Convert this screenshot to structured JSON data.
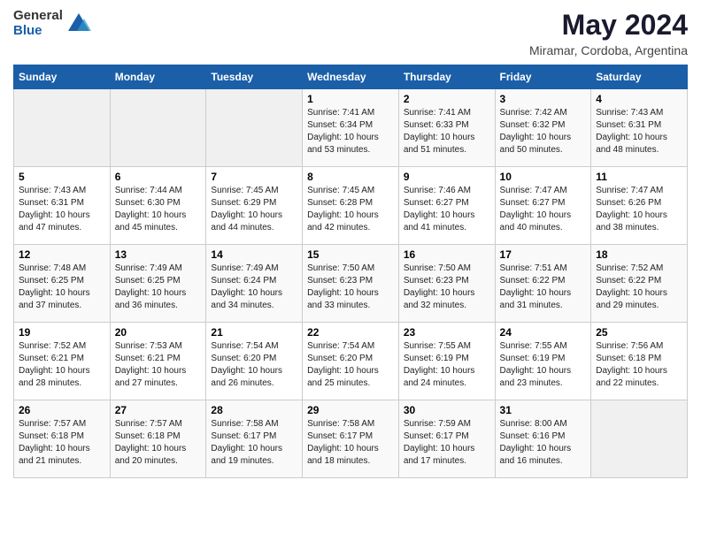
{
  "logo": {
    "general": "General",
    "blue": "Blue"
  },
  "title": "May 2024",
  "subtitle": "Miramar, Cordoba, Argentina",
  "days_of_week": [
    "Sunday",
    "Monday",
    "Tuesday",
    "Wednesday",
    "Thursday",
    "Friday",
    "Saturday"
  ],
  "weeks": [
    [
      {
        "num": "",
        "info": ""
      },
      {
        "num": "",
        "info": ""
      },
      {
        "num": "",
        "info": ""
      },
      {
        "num": "1",
        "info": "Sunrise: 7:41 AM\nSunset: 6:34 PM\nDaylight: 10 hours\nand 53 minutes."
      },
      {
        "num": "2",
        "info": "Sunrise: 7:41 AM\nSunset: 6:33 PM\nDaylight: 10 hours\nand 51 minutes."
      },
      {
        "num": "3",
        "info": "Sunrise: 7:42 AM\nSunset: 6:32 PM\nDaylight: 10 hours\nand 50 minutes."
      },
      {
        "num": "4",
        "info": "Sunrise: 7:43 AM\nSunset: 6:31 PM\nDaylight: 10 hours\nand 48 minutes."
      }
    ],
    [
      {
        "num": "5",
        "info": "Sunrise: 7:43 AM\nSunset: 6:31 PM\nDaylight: 10 hours\nand 47 minutes."
      },
      {
        "num": "6",
        "info": "Sunrise: 7:44 AM\nSunset: 6:30 PM\nDaylight: 10 hours\nand 45 minutes."
      },
      {
        "num": "7",
        "info": "Sunrise: 7:45 AM\nSunset: 6:29 PM\nDaylight: 10 hours\nand 44 minutes."
      },
      {
        "num": "8",
        "info": "Sunrise: 7:45 AM\nSunset: 6:28 PM\nDaylight: 10 hours\nand 42 minutes."
      },
      {
        "num": "9",
        "info": "Sunrise: 7:46 AM\nSunset: 6:27 PM\nDaylight: 10 hours\nand 41 minutes."
      },
      {
        "num": "10",
        "info": "Sunrise: 7:47 AM\nSunset: 6:27 PM\nDaylight: 10 hours\nand 40 minutes."
      },
      {
        "num": "11",
        "info": "Sunrise: 7:47 AM\nSunset: 6:26 PM\nDaylight: 10 hours\nand 38 minutes."
      }
    ],
    [
      {
        "num": "12",
        "info": "Sunrise: 7:48 AM\nSunset: 6:25 PM\nDaylight: 10 hours\nand 37 minutes."
      },
      {
        "num": "13",
        "info": "Sunrise: 7:49 AM\nSunset: 6:25 PM\nDaylight: 10 hours\nand 36 minutes."
      },
      {
        "num": "14",
        "info": "Sunrise: 7:49 AM\nSunset: 6:24 PM\nDaylight: 10 hours\nand 34 minutes."
      },
      {
        "num": "15",
        "info": "Sunrise: 7:50 AM\nSunset: 6:23 PM\nDaylight: 10 hours\nand 33 minutes."
      },
      {
        "num": "16",
        "info": "Sunrise: 7:50 AM\nSunset: 6:23 PM\nDaylight: 10 hours\nand 32 minutes."
      },
      {
        "num": "17",
        "info": "Sunrise: 7:51 AM\nSunset: 6:22 PM\nDaylight: 10 hours\nand 31 minutes."
      },
      {
        "num": "18",
        "info": "Sunrise: 7:52 AM\nSunset: 6:22 PM\nDaylight: 10 hours\nand 29 minutes."
      }
    ],
    [
      {
        "num": "19",
        "info": "Sunrise: 7:52 AM\nSunset: 6:21 PM\nDaylight: 10 hours\nand 28 minutes."
      },
      {
        "num": "20",
        "info": "Sunrise: 7:53 AM\nSunset: 6:21 PM\nDaylight: 10 hours\nand 27 minutes."
      },
      {
        "num": "21",
        "info": "Sunrise: 7:54 AM\nSunset: 6:20 PM\nDaylight: 10 hours\nand 26 minutes."
      },
      {
        "num": "22",
        "info": "Sunrise: 7:54 AM\nSunset: 6:20 PM\nDaylight: 10 hours\nand 25 minutes."
      },
      {
        "num": "23",
        "info": "Sunrise: 7:55 AM\nSunset: 6:19 PM\nDaylight: 10 hours\nand 24 minutes."
      },
      {
        "num": "24",
        "info": "Sunrise: 7:55 AM\nSunset: 6:19 PM\nDaylight: 10 hours\nand 23 minutes."
      },
      {
        "num": "25",
        "info": "Sunrise: 7:56 AM\nSunset: 6:18 PM\nDaylight: 10 hours\nand 22 minutes."
      }
    ],
    [
      {
        "num": "26",
        "info": "Sunrise: 7:57 AM\nSunset: 6:18 PM\nDaylight: 10 hours\nand 21 minutes."
      },
      {
        "num": "27",
        "info": "Sunrise: 7:57 AM\nSunset: 6:18 PM\nDaylight: 10 hours\nand 20 minutes."
      },
      {
        "num": "28",
        "info": "Sunrise: 7:58 AM\nSunset: 6:17 PM\nDaylight: 10 hours\nand 19 minutes."
      },
      {
        "num": "29",
        "info": "Sunrise: 7:58 AM\nSunset: 6:17 PM\nDaylight: 10 hours\nand 18 minutes."
      },
      {
        "num": "30",
        "info": "Sunrise: 7:59 AM\nSunset: 6:17 PM\nDaylight: 10 hours\nand 17 minutes."
      },
      {
        "num": "31",
        "info": "Sunrise: 8:00 AM\nSunset: 6:16 PM\nDaylight: 10 hours\nand 16 minutes."
      },
      {
        "num": "",
        "info": ""
      }
    ]
  ]
}
